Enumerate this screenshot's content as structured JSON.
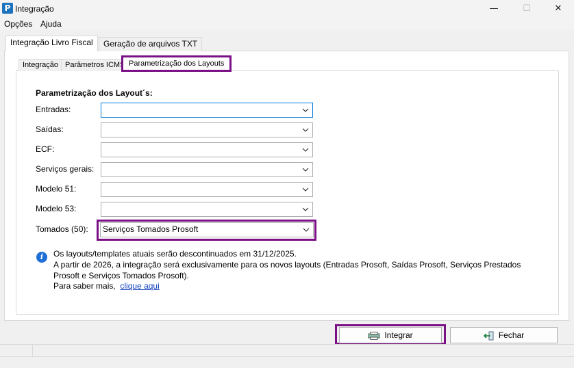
{
  "window": {
    "title": "Integração",
    "app_icon_letter": "P"
  },
  "menu": {
    "items": [
      "Opções",
      "Ajuda"
    ]
  },
  "main_tabs": [
    {
      "label": "Integração Livro Fiscal",
      "active": true
    },
    {
      "label": "Geração de arquivos TXT",
      "active": false
    }
  ],
  "sub_tabs": [
    {
      "label": "Integração",
      "active": false
    },
    {
      "label": "Parâmetros ICMS",
      "active": false
    },
    {
      "label": "Parametrização dos Layouts",
      "active": true
    }
  ],
  "section_title": "Parametrização dos Layout´s:",
  "fields": [
    {
      "label": "Entradas:",
      "value": ""
    },
    {
      "label": "Saídas:",
      "value": ""
    },
    {
      "label": "ECF:",
      "value": ""
    },
    {
      "label": "Serviços gerais:",
      "value": ""
    },
    {
      "label": "Modelo 51:",
      "value": ""
    },
    {
      "label": "Modelo 53:",
      "value": ""
    },
    {
      "label": "Tomados (50):",
      "value": "Serviços Tomados Prosoft"
    }
  ],
  "info": {
    "line1": "Os layouts/templates atuais serão descontinuados em 31/12/2025.",
    "line2": "A partir de 2026, a integração será exclusivamente para os novos layouts (Entradas Prosoft, Saídas Prosoft, Serviços Prestados",
    "line3": "Prosoft e Serviços Tomados Prosoft).",
    "line4_prefix": "Para saber mais,",
    "link": "clique aqui"
  },
  "buttons": {
    "integrar": "Integrar",
    "fechar": "Fechar"
  },
  "colors": {
    "highlight": "#7a0f86",
    "link": "#1040c0",
    "info_icon": "#1d6fd6",
    "app_icon": "#1e73be"
  }
}
